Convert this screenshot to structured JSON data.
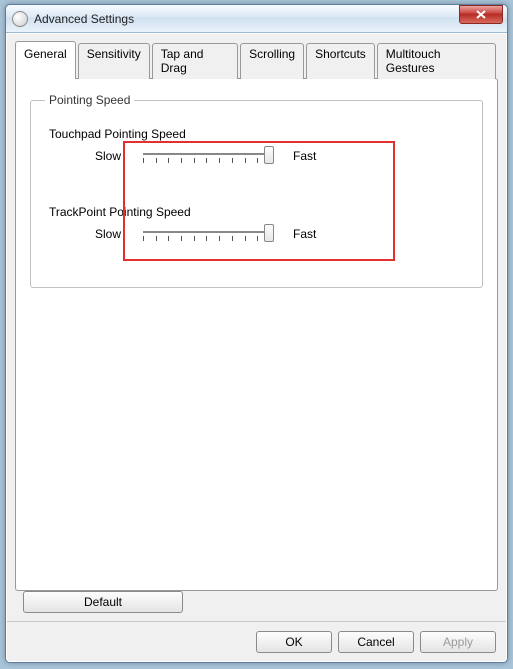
{
  "window": {
    "title": "Advanced Settings"
  },
  "tabs": {
    "general": "General",
    "sensitivity": "Sensitivity",
    "tap_and_drag": "Tap and Drag",
    "scrolling": "Scrolling",
    "shortcuts": "Shortcuts",
    "multitouch": "Multitouch Gestures",
    "active": "general"
  },
  "group": {
    "title": "Pointing Speed",
    "touchpad": {
      "heading": "Touchpad Pointing Speed",
      "slow": "Slow",
      "fast": "Fast",
      "value": 10,
      "max": 10
    },
    "trackpoint": {
      "heading": "TrackPoint Pointing Speed",
      "slow": "Slow",
      "fast": "Fast",
      "value": 10,
      "max": 10
    }
  },
  "buttons": {
    "default": "Default",
    "ok": "OK",
    "cancel": "Cancel",
    "apply": "Apply"
  }
}
